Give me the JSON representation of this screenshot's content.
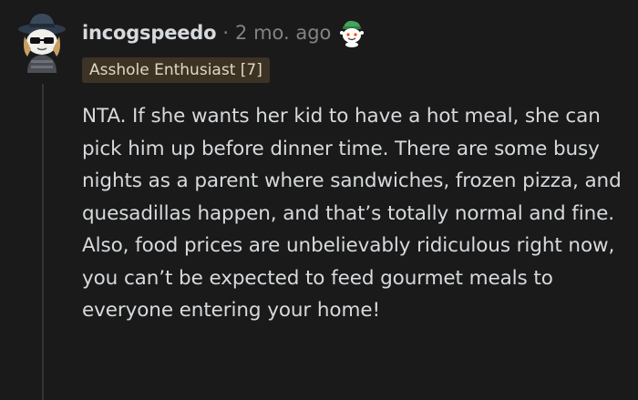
{
  "comment": {
    "author": "incogspeedo",
    "separator": "·",
    "time": "2 mo. ago",
    "flair": "Asshole Enthusiast [7]",
    "body": "NTA. If she wants her kid to have a hot meal, she can pick him up before dinner time. There are some busy nights as a parent where sandwiches, frozen pizza, and quesadillas happen, and that’s totally normal and fine. Also, food prices are unbelievably ridiculous right now, you can’t be expected to feed gourmet meals to everyone entering your home!",
    "award_icon": "snoo-award-icon",
    "avatar_icon": "snoo-avatar-icon"
  },
  "colors": {
    "background": "#1a1a1b",
    "text": "#d7dadc",
    "meta": "#818384",
    "flair_bg": "#3d3324",
    "thread_line": "#343536"
  }
}
